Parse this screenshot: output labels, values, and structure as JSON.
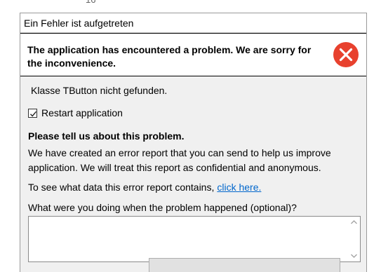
{
  "background": {
    "partial_label": "16"
  },
  "dialog": {
    "title": "Ein Fehler ist aufgetreten",
    "header_message": "The application has encountered a problem. We are sorry for the inconvenience.",
    "error_icon": "error-x-circle-icon",
    "error_detail": "Klasse TButton nicht gefunden.",
    "restart_checkbox": {
      "label": "Restart application",
      "checked": true
    },
    "tell_heading": "Please tell us about this problem.",
    "description": "We have created an error report that you can send to help us improve application. We will treat this report as confidential and anonymous.",
    "see_data_text": "To see what data this error report contains,",
    "see_data_link": "click here.",
    "optional_label": "What were you doing when the problem happened (optional)?",
    "optional_input_value": ""
  },
  "colors": {
    "error_red": "#e8412e",
    "link_blue": "#0066cc",
    "dialog_bg": "#f0f0f0"
  }
}
